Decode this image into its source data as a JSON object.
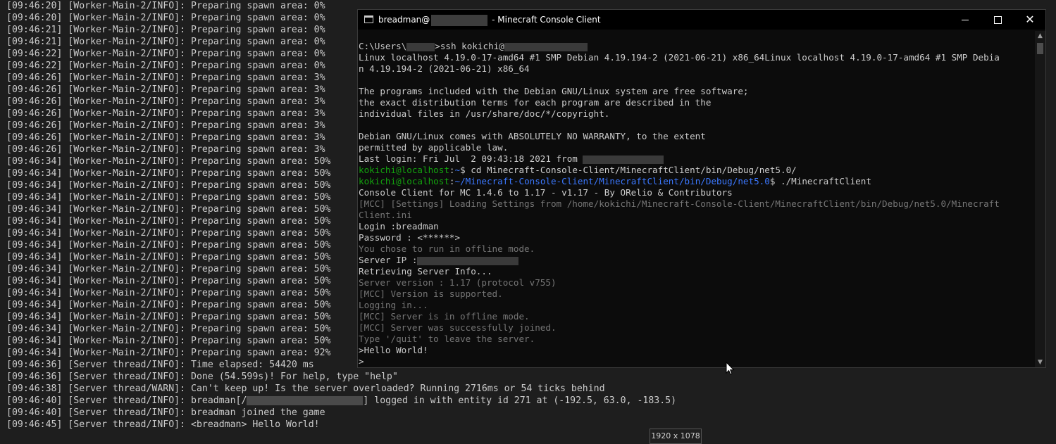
{
  "background_log": {
    "lines": [
      "[09:46:20] [Worker-Main-2/INFO]: Preparing spawn area: 0%",
      "[09:46:20] [Worker-Main-2/INFO]: Preparing spawn area: 0%",
      "[09:46:21] [Worker-Main-2/INFO]: Preparing spawn area: 0%",
      "[09:46:21] [Worker-Main-2/INFO]: Preparing spawn area: 0%",
      "[09:46:22] [Worker-Main-2/INFO]: Preparing spawn area: 0%",
      "[09:46:22] [Worker-Main-2/INFO]: Preparing spawn area: 0%",
      "[09:46:26] [Worker-Main-2/INFO]: Preparing spawn area: 3%",
      "[09:46:26] [Worker-Main-2/INFO]: Preparing spawn area: 3%",
      "[09:46:26] [Worker-Main-2/INFO]: Preparing spawn area: 3%",
      "[09:46:26] [Worker-Main-2/INFO]: Preparing spawn area: 3%",
      "[09:46:26] [Worker-Main-2/INFO]: Preparing spawn area: 3%",
      "[09:46:26] [Worker-Main-2/INFO]: Preparing spawn area: 3%",
      "[09:46:26] [Worker-Main-2/INFO]: Preparing spawn area: 3%",
      "[09:46:34] [Worker-Main-2/INFO]: Preparing spawn area: 50%",
      "[09:46:34] [Worker-Main-2/INFO]: Preparing spawn area: 50%",
      "[09:46:34] [Worker-Main-2/INFO]: Preparing spawn area: 50%",
      "[09:46:34] [Worker-Main-2/INFO]: Preparing spawn area: 50%",
      "[09:46:34] [Worker-Main-2/INFO]: Preparing spawn area: 50%",
      "[09:46:34] [Worker-Main-2/INFO]: Preparing spawn area: 50%",
      "[09:46:34] [Worker-Main-2/INFO]: Preparing spawn area: 50%",
      "[09:46:34] [Worker-Main-2/INFO]: Preparing spawn area: 50%",
      "[09:46:34] [Worker-Main-2/INFO]: Preparing spawn area: 50%",
      "[09:46:34] [Worker-Main-2/INFO]: Preparing spawn area: 50%",
      "[09:46:34] [Worker-Main-2/INFO]: Preparing spawn area: 50%",
      "[09:46:34] [Worker-Main-2/INFO]: Preparing spawn area: 50%",
      "[09:46:34] [Worker-Main-2/INFO]: Preparing spawn area: 50%",
      "[09:46:34] [Worker-Main-2/INFO]: Preparing spawn area: 50%",
      "[09:46:34] [Worker-Main-2/INFO]: Preparing spawn area: 50%",
      "[09:46:34] [Worker-Main-2/INFO]: Preparing spawn area: 50%",
      "[09:46:34] [Worker-Main-2/INFO]: Preparing spawn area: 92%",
      "[09:46:36] [Server thread/INFO]: Time elapsed: 54420 ms",
      "[09:46:36] [Server thread/INFO]: Done (54.599s)! For help, type \"help\"",
      "[09:46:38] [Server thread/WARN]: Can't keep up! Is the server overloaded? Running 2716ms or 54 ticks behind"
    ],
    "login_prefix": "[09:46:40] [Server thread/INFO]: breadman[/",
    "login_suffix": "] logged in with entity id 271 at (-192.5, 63.0, -183.5)",
    "joined_line": "[09:46:40] [Server thread/INFO]: breadman joined the game",
    "chat_line": "[09:46:45] [Server thread/INFO]: <breadman> Hello World!"
  },
  "window": {
    "title_prefix": "breadman@",
    "title_suffix": " - Minecraft Console Client",
    "icon": "console-app-icon",
    "controls": {
      "minimize": "minimize-icon",
      "maximize": "maximize-icon",
      "close": "close-icon"
    }
  },
  "terminal": {
    "ssh_prefix": "C:\\Users\\",
    "ssh_middle": ">ssh kokichi@",
    "uname_1": "Linux localhost 4.19.0-17-amd64 #1 SMP Debian 4.19.194-2 (2021-06-21) x86_64Linux localhost 4.19.0-17-amd64 #1 SMP Debia",
    "uname_2": "n 4.19.194-2 (2021-06-21) x86_64",
    "motd_1": "The programs included with the Debian GNU/Linux system are free software;",
    "motd_2": "the exact distribution terms for each program are described in the",
    "motd_3": "individual files in /usr/share/doc/*/copyright.",
    "warranty_1": "Debian GNU/Linux comes with ABSOLUTELY NO WARRANTY, to the extent",
    "warranty_2": "permitted by applicable law.",
    "last_login": "Last login: Fri Jul  2 09:43:18 2021 from ",
    "prompt_user": "kokichi@localhost",
    "prompt_colon": ":",
    "prompt1_path": "~",
    "prompt1_cmd": "$ cd Minecraft-Console-Client/MinecraftClient/bin/Debug/net5.0/",
    "prompt2_path": "~/Minecraft-Console-Client/MinecraftClient/bin/Debug/net5.0",
    "prompt2_cmd": "$ ./MinecraftClient",
    "banner": "Console Client for MC 1.4.6 to 1.17 - v1.17 - By ORelio & Contributors",
    "settings_1": "[MCC] [Settings] Loading Settings from /home/kokichi/Minecraft-Console-Client/MinecraftClient/bin/Debug/net5.0/Minecraft",
    "settings_2": "Client.ini",
    "login": "Login :breadman",
    "password": "Password : <******>",
    "offline_choice": "You chose to run in offline mode.",
    "server_ip": "Server IP :",
    "retrieving": "Retrieving Server Info...",
    "server_version": "Server version : 1.17 (protocol v755)",
    "version_supported": "[MCC] Version is supported.",
    "logging_in": "Logging in...",
    "offline_mode": "[MCC] Server is in offline mode.",
    "joined": "[MCC] Server was successfully joined.",
    "quit_hint": "Type '/quit' to leave the server.",
    "hello": ">Hello World!",
    "input_prompt": ">"
  },
  "tooltip": "1920 x 1078",
  "colors": {
    "prompt_user": "#13a10e",
    "prompt_path": "#3b78ff",
    "info_gray": "#767676",
    "terminal_bg": "#0c0c0c"
  }
}
